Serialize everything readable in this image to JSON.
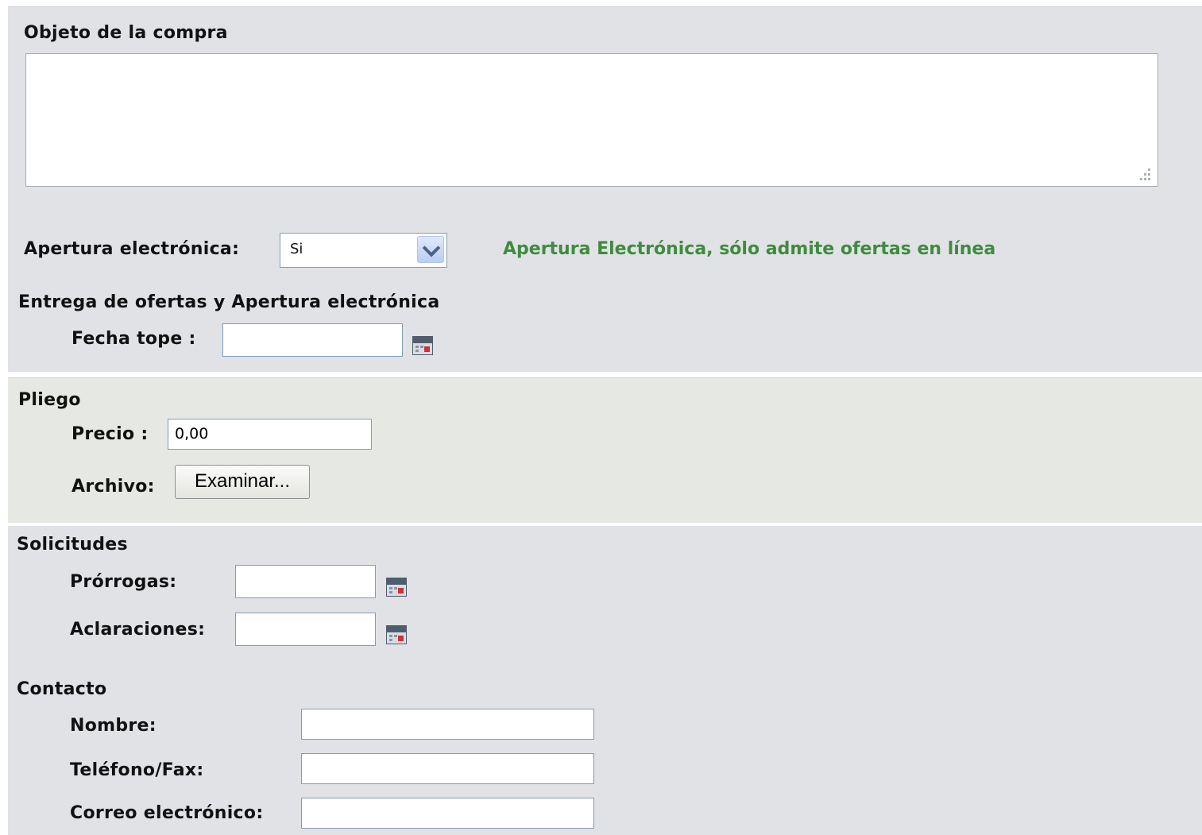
{
  "objeto": {
    "label": "Objeto de la compra",
    "value": ""
  },
  "apertura": {
    "label": "Apertura electrónica:",
    "selected": "Si",
    "note": "Apertura Electrónica, sólo admite ofertas en línea"
  },
  "entrega": {
    "heading": "Entrega de ofertas y Apertura electrónica",
    "fecha_label": "Fecha tope :",
    "fecha_value": ""
  },
  "pliego": {
    "heading": "Pliego",
    "precio_label": "Precio :",
    "precio_value": "0,00",
    "archivo_label": "Archivo:",
    "examinar_label": "Examinar..."
  },
  "solicitudes": {
    "heading": "Solicitudes",
    "prorrogas_label": "Prórrogas:",
    "prorrogas_value": "",
    "aclaraciones_label": "Aclaraciones:",
    "aclaraciones_value": ""
  },
  "contacto": {
    "heading": "Contacto",
    "nombre_label": "Nombre:",
    "nombre_value": "",
    "telefono_label": "Teléfono/Fax:",
    "telefono_value": "",
    "correo_label": "Correo electrónico:",
    "correo_value": ""
  },
  "icons": {
    "calendar": "calendar-icon",
    "dropdown": "chevron-down-icon",
    "resize": "resize-grip-icon"
  },
  "colors": {
    "section_gray": "#e1e2e6",
    "section_green": "#e6e9e3",
    "note_green": "#3f8b3f"
  }
}
